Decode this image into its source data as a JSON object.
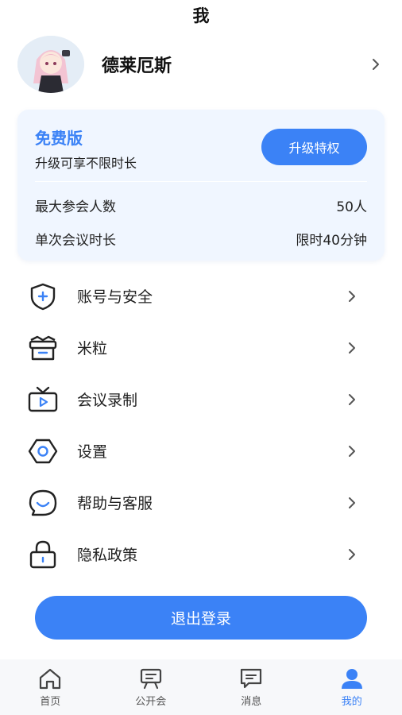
{
  "header": {
    "title": "我"
  },
  "profile": {
    "name": "德莱厄斯"
  },
  "plan": {
    "name": "免费版",
    "subtitle": "升级可享不限时长",
    "upgrade_label": "升级特权",
    "rows": [
      {
        "label": "最大参会人数",
        "value": "50人"
      },
      {
        "label": "单次会议时长",
        "value": "限时40分钟"
      }
    ]
  },
  "menu": {
    "items": [
      {
        "label": "账号与安全",
        "icon": "shield-icon"
      },
      {
        "label": "米粒",
        "icon": "gift-box-icon"
      },
      {
        "label": "会议录制",
        "icon": "video-record-icon"
      },
      {
        "label": "设置",
        "icon": "settings-icon"
      },
      {
        "label": "帮助与客服",
        "icon": "customer-service-icon"
      },
      {
        "label": "隐私政策",
        "icon": "lock-icon"
      }
    ]
  },
  "logout": {
    "label": "退出登录"
  },
  "tabbar": {
    "tabs": [
      {
        "label": "首页",
        "icon": "home-icon"
      },
      {
        "label": "公开会",
        "icon": "public-meeting-icon"
      },
      {
        "label": "消息",
        "icon": "message-icon"
      },
      {
        "label": "我的",
        "icon": "user-icon"
      }
    ],
    "active_index": 3
  },
  "colors": {
    "accent": "#3b82f6",
    "card_bg": "#f0f6ff",
    "tabbar_bg": "#f7f8fa"
  }
}
